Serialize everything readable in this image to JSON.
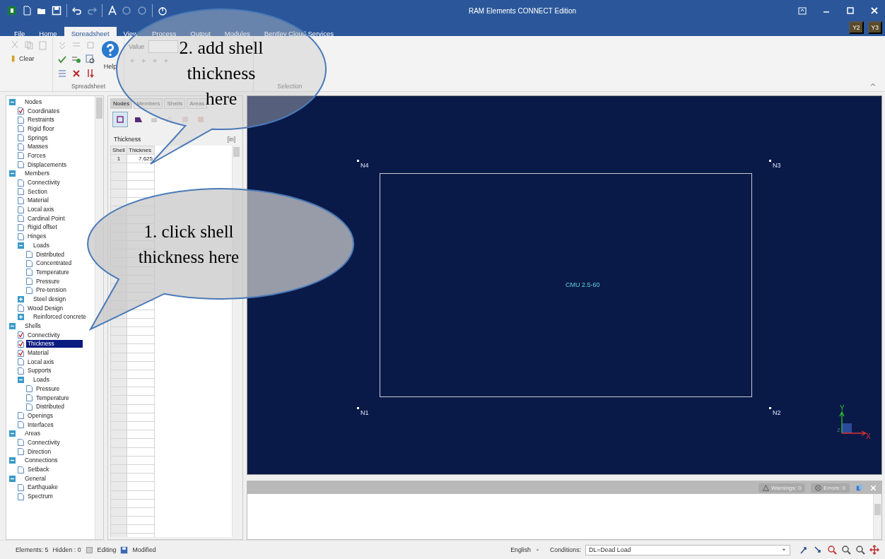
{
  "window": {
    "title": "RAM Elements CONNECT Edition"
  },
  "ribbon_tabs": [
    {
      "label": "File",
      "selected": false
    },
    {
      "label": "Home",
      "selected": false
    },
    {
      "label": "Spreadsheet",
      "selected": true
    },
    {
      "label": "View",
      "selected": false
    },
    {
      "label": "Process",
      "selected": false
    },
    {
      "label": "Output",
      "selected": false
    },
    {
      "label": "Modules",
      "selected": false
    },
    {
      "label": "Bentley Cloud Services",
      "selected": false
    }
  ],
  "view_badges": [
    "Y2",
    "Y3"
  ],
  "ribbon": {
    "clear": "Clear",
    "help": "Help",
    "value_label": "Value",
    "groups": [
      "Spreadsheet",
      "Selection"
    ]
  },
  "callouts": [
    {
      "text": "2. add shell thickness here"
    },
    {
      "text": "1. click shell thickness here"
    }
  ],
  "tree": [
    {
      "label": "Nodes",
      "kind": "folder",
      "expanded": true,
      "selected": false,
      "children": [
        {
          "label": "Coordinates",
          "kind": "sheet",
          "checked": true,
          "selected": false
        },
        {
          "label": "Restraints",
          "kind": "sheet",
          "checked": false,
          "selected": false
        },
        {
          "label": "Rigid floor",
          "kind": "sheet",
          "checked": false,
          "selected": false
        },
        {
          "label": "Springs",
          "kind": "sheet",
          "checked": false,
          "selected": false
        },
        {
          "label": "Masses",
          "kind": "sheet",
          "checked": false,
          "selected": false
        },
        {
          "label": "Forces",
          "kind": "sheet",
          "checked": false,
          "selected": false
        },
        {
          "label": "Displacements",
          "kind": "sheet",
          "checked": false,
          "selected": false
        }
      ]
    },
    {
      "label": "Members",
      "kind": "folder",
      "expanded": true,
      "selected": false,
      "children": [
        {
          "label": "Connectivity",
          "kind": "sheet",
          "checked": false,
          "selected": false
        },
        {
          "label": "Section",
          "kind": "sheet",
          "checked": false,
          "selected": false
        },
        {
          "label": "Material",
          "kind": "sheet",
          "checked": false,
          "selected": false
        },
        {
          "label": "Local axis",
          "kind": "sheet",
          "checked": false,
          "selected": false
        },
        {
          "label": "Cardinal Point",
          "kind": "sheet",
          "checked": false,
          "selected": false
        },
        {
          "label": "Rigid offset",
          "kind": "sheet",
          "checked": false,
          "selected": false
        },
        {
          "label": "Hinges",
          "kind": "sheet",
          "checked": false,
          "selected": false
        },
        {
          "label": "Loads",
          "kind": "folder",
          "expanded": true,
          "selected": false,
          "children": [
            {
              "label": "Distributed",
              "kind": "sheet",
              "checked": false,
              "selected": false
            },
            {
              "label": "Concentrated",
              "kind": "sheet",
              "checked": false,
              "selected": false
            },
            {
              "label": "Temperature",
              "kind": "sheet",
              "checked": false,
              "selected": false
            },
            {
              "label": "Pressure",
              "kind": "sheet",
              "checked": false,
              "selected": false
            },
            {
              "label": "Pre-tension",
              "kind": "sheet",
              "checked": false,
              "selected": false
            }
          ]
        },
        {
          "label": "Steel design",
          "kind": "folder",
          "expanded": false,
          "selected": false
        },
        {
          "label": "Wood Design",
          "kind": "sheet",
          "checked": false,
          "selected": false
        },
        {
          "label": "Reinforced concrete",
          "kind": "folder",
          "expanded": false,
          "selected": false
        }
      ]
    },
    {
      "label": "Shells",
      "kind": "folder",
      "expanded": true,
      "selected": false,
      "children": [
        {
          "label": "Connectivity",
          "kind": "sheet",
          "checked": true,
          "selected": false
        },
        {
          "label": "Thickness",
          "kind": "sheet",
          "checked": true,
          "selected": true
        },
        {
          "label": "Material",
          "kind": "sheet",
          "checked": true,
          "selected": false
        },
        {
          "label": "Local axis",
          "kind": "sheet",
          "checked": false,
          "selected": false
        },
        {
          "label": "Supports",
          "kind": "sheet",
          "checked": false,
          "selected": false
        },
        {
          "label": "Loads",
          "kind": "folder",
          "expanded": true,
          "selected": false,
          "children": [
            {
              "label": "Pressure",
              "kind": "sheet",
              "checked": false,
              "selected": false
            },
            {
              "label": "Temperature",
              "kind": "sheet",
              "checked": false,
              "selected": false
            },
            {
              "label": "Distributed",
              "kind": "sheet",
              "checked": false,
              "selected": false
            }
          ]
        },
        {
          "label": "Openings",
          "kind": "sheet",
          "checked": false,
          "selected": false
        },
        {
          "label": "Interfaces",
          "kind": "sheet",
          "checked": false,
          "selected": false
        }
      ]
    },
    {
      "label": "Areas",
      "kind": "folder",
      "expanded": true,
      "selected": false,
      "children": [
        {
          "label": "Connectivity",
          "kind": "sheet",
          "checked": false,
          "selected": false
        },
        {
          "label": "Direction",
          "kind": "sheet",
          "checked": false,
          "selected": false
        }
      ]
    },
    {
      "label": "Connections",
      "kind": "folder",
      "expanded": true,
      "selected": false,
      "children": [
        {
          "label": "Setback",
          "kind": "sheet",
          "checked": false,
          "selected": false
        }
      ]
    },
    {
      "label": "General",
      "kind": "folder",
      "expanded": true,
      "selected": false,
      "children": [
        {
          "label": "Earthquake",
          "kind": "sheet",
          "checked": false,
          "selected": false
        },
        {
          "label": "Spectrum",
          "kind": "sheet",
          "checked": false,
          "selected": false
        }
      ]
    }
  ],
  "sheet_tabs": [
    {
      "label": "Nodes",
      "selected": true
    },
    {
      "label": "Members",
      "selected": false
    },
    {
      "label": "Shells",
      "selected": false
    },
    {
      "label": "Areas",
      "selected": false
    }
  ],
  "sheet": {
    "title": "Thickness",
    "unit": "[in]",
    "columns": [
      "Shell",
      "Thicknes"
    ],
    "rows": [
      [
        "1",
        "7.625"
      ]
    ]
  },
  "viewport": {
    "nodes": [
      {
        "label": "N4"
      },
      {
        "label": "N3"
      },
      {
        "label": "N1"
      },
      {
        "label": "N2"
      }
    ],
    "area_label": "CMU 2.5-60",
    "axes": [
      "Y",
      "Z",
      "X"
    ]
  },
  "messages": {
    "warnings": "Warnings: 0",
    "errors": "Errors: 0"
  },
  "status_bar": {
    "elements": "Elements: 5",
    "hidden": "Hidden : 0",
    "editing": "Editing",
    "modified": "Modified",
    "language": "English",
    "conditions_label": "Conditions:",
    "condition": "DL=Dead Load"
  }
}
